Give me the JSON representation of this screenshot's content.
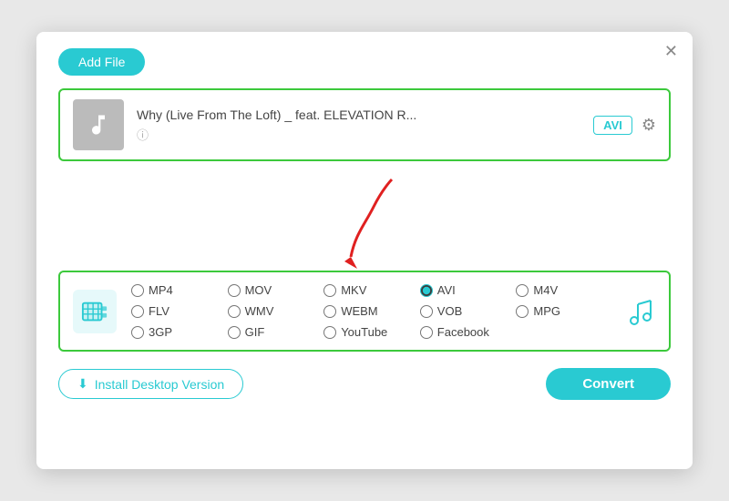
{
  "dialog": {
    "close_label": "✕"
  },
  "header": {
    "add_file_label": "Add File"
  },
  "file": {
    "title": "Why (Live From The Loft) _ feat. ELEVATION R...",
    "format": "AVI",
    "info_icon": "ⓘ"
  },
  "formats": {
    "video_icon_label": "video-icon",
    "music_icon_label": "music-note-icon",
    "options": [
      {
        "label": "MP4",
        "value": "mp4",
        "checked": false
      },
      {
        "label": "MOV",
        "value": "mov",
        "checked": false
      },
      {
        "label": "MKV",
        "value": "mkv",
        "checked": false
      },
      {
        "label": "AVI",
        "value": "avi",
        "checked": true
      },
      {
        "label": "M4V",
        "value": "m4v",
        "checked": false
      },
      {
        "label": "FLV",
        "value": "flv",
        "checked": false
      },
      {
        "label": "WMV",
        "value": "wmv",
        "checked": false
      },
      {
        "label": "WEBM",
        "value": "webm",
        "checked": false
      },
      {
        "label": "VOB",
        "value": "vob",
        "checked": false
      },
      {
        "label": "MPG",
        "value": "mpg",
        "checked": false
      },
      {
        "label": "3GP",
        "value": "3gp",
        "checked": false
      },
      {
        "label": "GIF",
        "value": "gif",
        "checked": false
      },
      {
        "label": "YouTube",
        "value": "youtube",
        "checked": false
      },
      {
        "label": "Facebook",
        "value": "facebook",
        "checked": false
      }
    ]
  },
  "bottom": {
    "install_label": "Install Desktop Version",
    "convert_label": "Convert"
  }
}
